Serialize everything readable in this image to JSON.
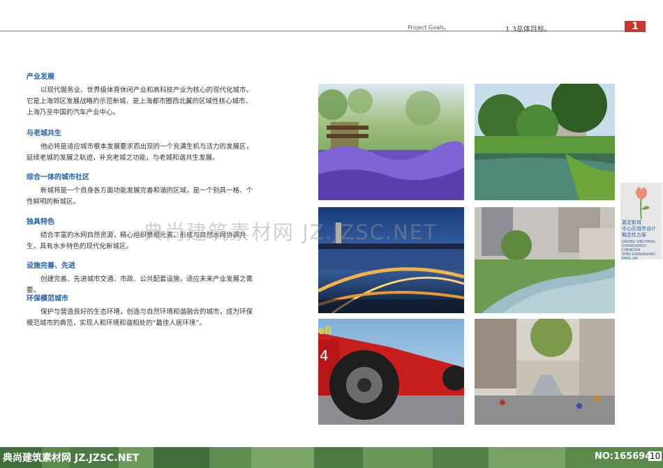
{
  "header": {
    "en_title": "Project Goals。",
    "cn_title": "1.3总体目标。",
    "badge": "1"
  },
  "sections": [
    {
      "title": "产业发展",
      "body": "以现代服务业、世界级体育休闲产业和高科技产业为核心的现代化城市。它是上海郊区发展战略的示范新城、是上海都市圈西北翼的区域性核心城市、上海乃至中国的汽车产业中心。"
    },
    {
      "title": "与老城共生",
      "body": "他必将是适应城市根本发展要求而出现的一个充满生机与活力的发展区，延续老城的发展之轨迹，补充老城之功能，与老城和谐共生发展。"
    },
    {
      "title": "综合一体的城市社区",
      "body": "新城将是一个自身各方面功能发展完善和谐的区域，是一个别具一格、个性鲜明的新城区。"
    },
    {
      "title": "独具特色",
      "body": "结合丰富的水网自然资源，精心组织景观元素，形成与自然水网协调共生，具有水乡特色的现代化新城区。"
    },
    {
      "title": "设施完善、先进",
      "body": "创建完善、先进城市交通、市政、公共配套设施，适应未来产业发展之需要。"
    },
    {
      "title": "环保模范城市",
      "body": "保护与营造良好的生态环境，创造与自然环境和谐融合的城市，成为环保模范城市的典范，实现人和环境和谐相处的“最佳人居环境”。"
    }
  ],
  "side_card": {
    "title_lines": [
      "嘉定新城",
      "中心区城市设计",
      "概念性方案"
    ],
    "pinyin_lines": [
      "JIADING XINCHENG",
      "ZHONGXINQU CHENGSHI",
      "SHEJI GAINIANXING",
      "FANG AN"
    ]
  },
  "watermark": "典尚建筑素材网  JZ.JZSC.NET",
  "footer": {
    "site": "典尚建筑素材网 JZ.JZSC.NET",
    "number": "NO:165694",
    "page": "10"
  },
  "photo_texts": {
    "car_number": "4",
    "car_sponsor": "ell"
  }
}
